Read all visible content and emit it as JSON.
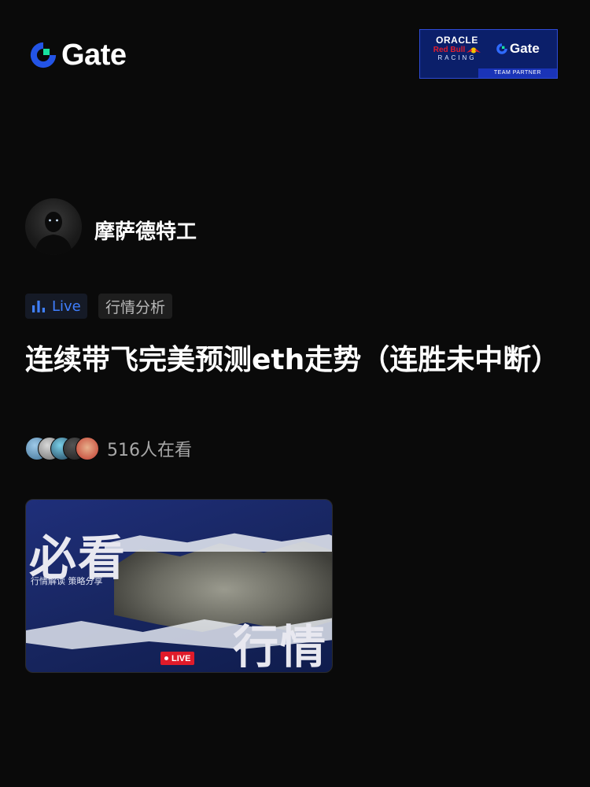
{
  "brand": {
    "logo_text": "Gate",
    "partner": {
      "line1": "ORACLE",
      "line2": "Red Bull",
      "line3": "RACING",
      "gate_text": "Gate",
      "footer": "TEAM PARTNER"
    },
    "colors": {
      "accent_blue": "#2354e6",
      "accent_green": "#17e3a0"
    }
  },
  "author": {
    "name": "摩萨德特工",
    "avatar_icon": "avatar-icon"
  },
  "tags": {
    "live_label": "Live",
    "live_icon": "bar-chart-icon",
    "category": "行情分析"
  },
  "post": {
    "title": "连续带飞完美预测eth走势（连胜未中断）"
  },
  "viewers": {
    "count_text": "516人在看"
  },
  "cover": {
    "headline1": "必看",
    "subtext": "行情解读 策略分享",
    "headline2": "行情",
    "live_badge": "LIVE"
  }
}
